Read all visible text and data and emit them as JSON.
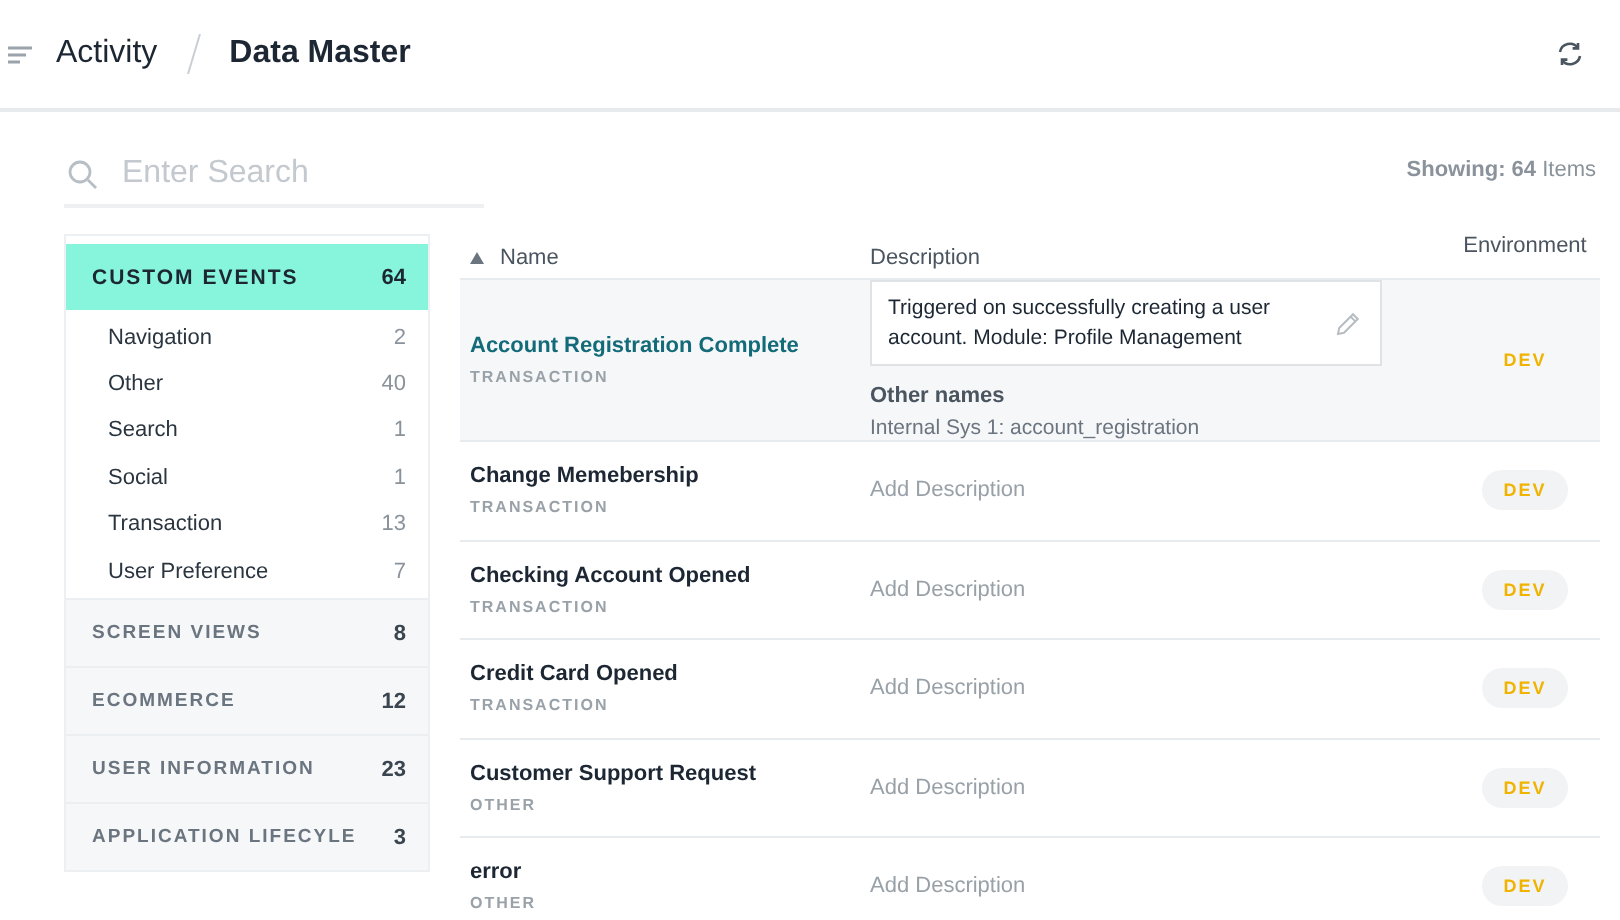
{
  "header": {
    "breadcrumb": [
      "Activity",
      "Data Master"
    ]
  },
  "search": {
    "placeholder": "Enter Search"
  },
  "showing": {
    "label": "Showing:",
    "count": "64",
    "unit": "Items"
  },
  "sidebar": {
    "groups": [
      {
        "label": "CUSTOM EVENTS",
        "count": "64",
        "selected": true,
        "expanded": true,
        "children": [
          {
            "label": "Navigation",
            "count": "2"
          },
          {
            "label": "Other",
            "count": "40"
          },
          {
            "label": "Search",
            "count": "1"
          },
          {
            "label": "Social",
            "count": "1"
          },
          {
            "label": "Transaction",
            "count": "13"
          },
          {
            "label": "User Preference",
            "count": "7"
          }
        ]
      },
      {
        "label": "SCREEN VIEWS",
        "count": "8",
        "selected": false,
        "expanded": false
      },
      {
        "label": "ECOMMERCE",
        "count": "12",
        "selected": false,
        "expanded": false
      },
      {
        "label": "USER INFORMATION",
        "count": "23",
        "selected": false,
        "expanded": false
      },
      {
        "label": "APPLICATION LIFECYLE",
        "count": "3",
        "selected": false,
        "expanded": false
      }
    ]
  },
  "table": {
    "columns": [
      {
        "label": "Name",
        "sorted": true
      },
      {
        "label": "Description",
        "sorted": false
      },
      {
        "label": "Environment",
        "sorted": false
      }
    ],
    "rows": [
      {
        "name": "Account Registration Complete",
        "category": "TRANSACTION",
        "selected": true,
        "description": "Triggered on successfully creating a user account. Module: Profile Management",
        "other_names_label": "Other names",
        "other_names": "Internal Sys 1: account_registration",
        "environment": "DEV"
      },
      {
        "name": "Change Memebership",
        "category": "TRANSACTION",
        "selected": false,
        "placeholder": "Add Description",
        "environment": "DEV"
      },
      {
        "name": "Checking Account Opened",
        "category": "TRANSACTION",
        "selected": false,
        "placeholder": "Add Description",
        "environment": "DEV"
      },
      {
        "name": "Credit Card Opened",
        "category": "TRANSACTION",
        "selected": false,
        "placeholder": "Add Description",
        "environment": "DEV"
      },
      {
        "name": "Customer Support Request",
        "category": "OTHER",
        "selected": false,
        "placeholder": "Add Description",
        "environment": "DEV"
      },
      {
        "name": "error",
        "category": "OTHER",
        "selected": false,
        "placeholder": "Add Description",
        "environment": "DEV"
      }
    ]
  }
}
